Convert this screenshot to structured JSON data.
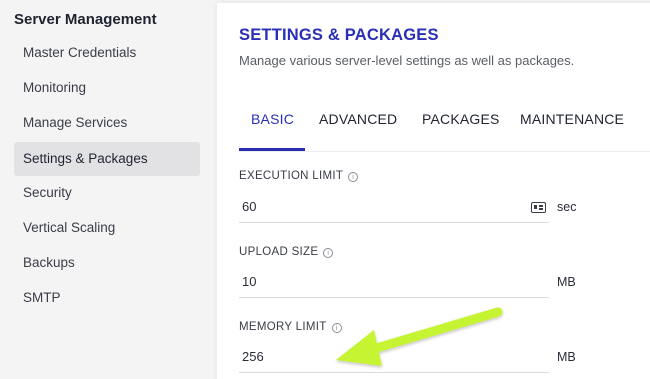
{
  "sidebar": {
    "title": "Server Management",
    "items": [
      {
        "label": "Master Credentials"
      },
      {
        "label": "Monitoring"
      },
      {
        "label": "Manage Services"
      },
      {
        "label": "Settings & Packages"
      },
      {
        "label": "Security"
      },
      {
        "label": "Vertical Scaling"
      },
      {
        "label": "Backups"
      },
      {
        "label": "SMTP"
      }
    ],
    "active_index": 3
  },
  "panel": {
    "title": "SETTINGS & PACKAGES",
    "subtitle": "Manage various server-level settings as well as packages.",
    "tabs": [
      {
        "label": "BASIC"
      },
      {
        "label": "ADVANCED"
      },
      {
        "label": "PACKAGES"
      },
      {
        "label": "MAINTENANCE"
      }
    ],
    "active_tab": "BASIC"
  },
  "fields": {
    "execution_limit": {
      "label": "EXECUTION LIMIT",
      "value": "60",
      "unit": "sec"
    },
    "upload_size": {
      "label": "UPLOAD SIZE",
      "value": "10",
      "unit": "MB"
    },
    "memory_limit": {
      "label": "MEMORY LIMIT",
      "value": "256",
      "unit": "MB"
    }
  },
  "icons": {
    "info": "info-icon",
    "card": "id-card-icon",
    "annotation": "arrow-annotation"
  },
  "colors": {
    "accent": "#2a2fb5",
    "arrow": "#c6f432"
  }
}
